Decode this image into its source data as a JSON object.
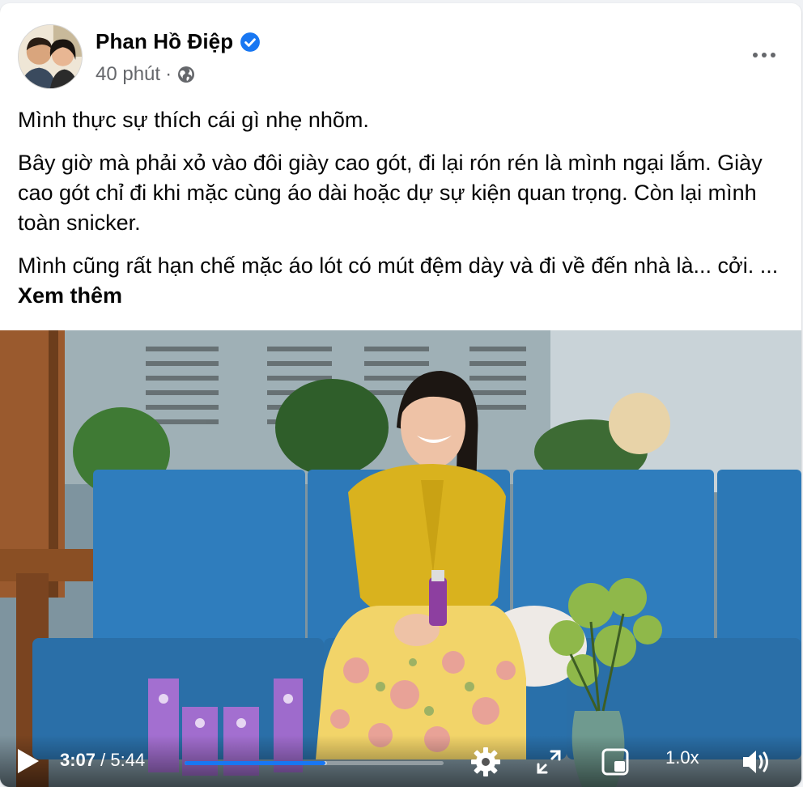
{
  "post": {
    "author": "Phan Hồ Điệp",
    "timestamp": "40 phút",
    "separator": "·",
    "privacy_icon": "globe-icon",
    "more_icon": "more-horizontal-icon",
    "paragraphs": [
      "Mình thực sự thích cái gì nhẹ nhõm.",
      "Bây giờ mà phải xỏ vào đôi giày cao gót, đi lại rón rén là mình ngại lắm. Giày cao gót chỉ đi khi mặc cùng áo dài hoặc dự sự kiện quan trọng. Còn lại mình toàn snicker."
    ],
    "last_paragraph": "Mình cũng rất hạn chế mặc áo lót có mút đệm dày và đi về đến nhà là... cởi. ...",
    "see_more": "Xem thêm"
  },
  "video": {
    "current_time": "3:07",
    "duration": "5:44",
    "time_separator": " / ",
    "progress": 0.544,
    "buffered": 0.55,
    "speed": "1.0x",
    "icons": [
      "play-icon",
      "settings-gear-icon",
      "fullscreen-icon",
      "picture-in-picture-icon",
      "volume-icon"
    ]
  },
  "colors": {
    "verified_badge": "#1877f2",
    "progress_played": "#1877f2",
    "secondary_text": "#65676b"
  }
}
